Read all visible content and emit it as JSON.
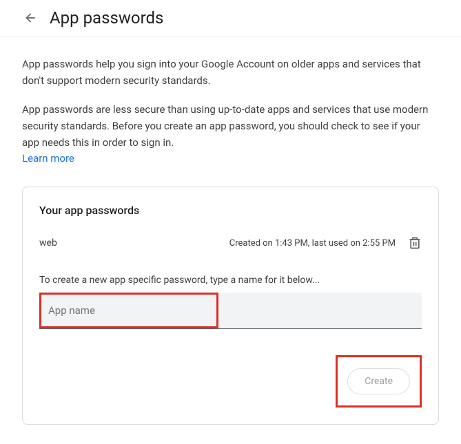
{
  "header": {
    "title": "App passwords"
  },
  "intro": {
    "p1": "App passwords help you sign into your Google Account on older apps and services that don't support modern security standards.",
    "p2": "App passwords are less secure than using up-to-date apps and services that use modern security standards. Before you create an app password, you should check to see if your app needs this in order to sign in.",
    "learn_more": "Learn more"
  },
  "card": {
    "title": "Your app passwords",
    "passwords": [
      {
        "name": "web",
        "meta": "Created on 1:43 PM, last used on 2:55 PM"
      }
    ],
    "create_instruction": "To create a new app specific password, type a name for it below...",
    "input_placeholder": "App name",
    "create_label": "Create"
  }
}
